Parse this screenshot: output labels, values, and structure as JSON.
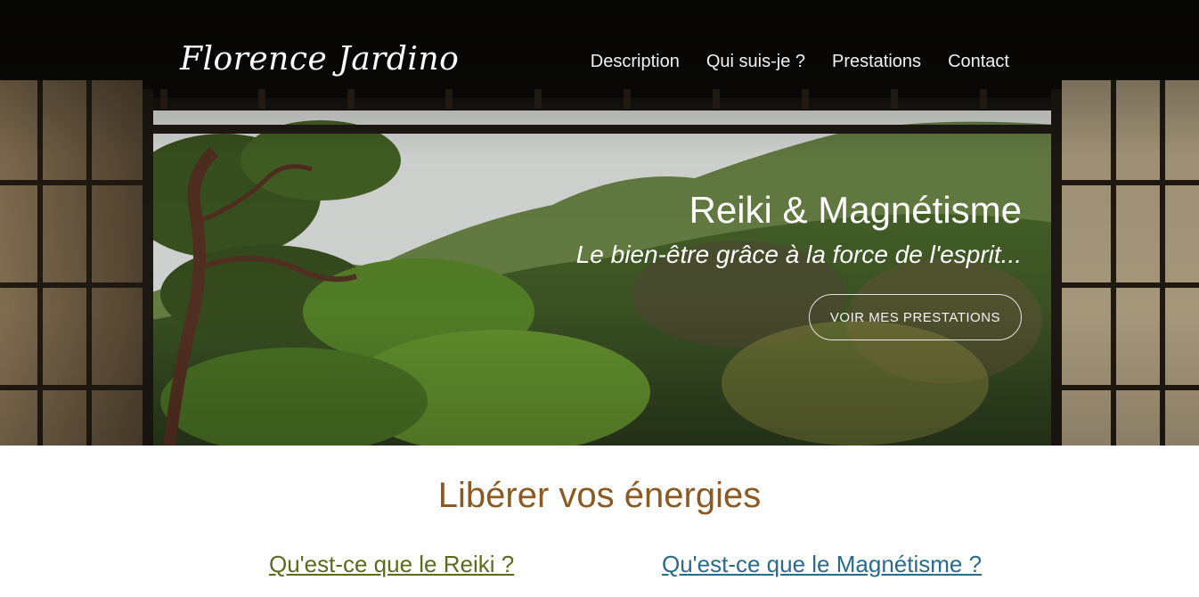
{
  "header": {
    "logo_text": "Florence Jardino",
    "nav": [
      {
        "label": "Description"
      },
      {
        "label": "Qui suis-je ?"
      },
      {
        "label": "Prestations"
      },
      {
        "label": "Contact"
      }
    ]
  },
  "hero": {
    "title": "Reiki & Magnétisme",
    "subtitle": "Le bien-être grâce à la force de l'esprit...",
    "cta_label": "VOIR MES PRESTATIONS"
  },
  "main": {
    "section_title": "Libérer vos énergies",
    "links": [
      {
        "label": "Qu'est-ce que le Reiki ?"
      },
      {
        "label": "Qu'est-ce que le Magnétisme ?"
      }
    ]
  },
  "colors": {
    "section_title": "#8a5a22",
    "link_reiki": "#5b6b1e",
    "link_magnetisme": "#2a6a8a"
  }
}
